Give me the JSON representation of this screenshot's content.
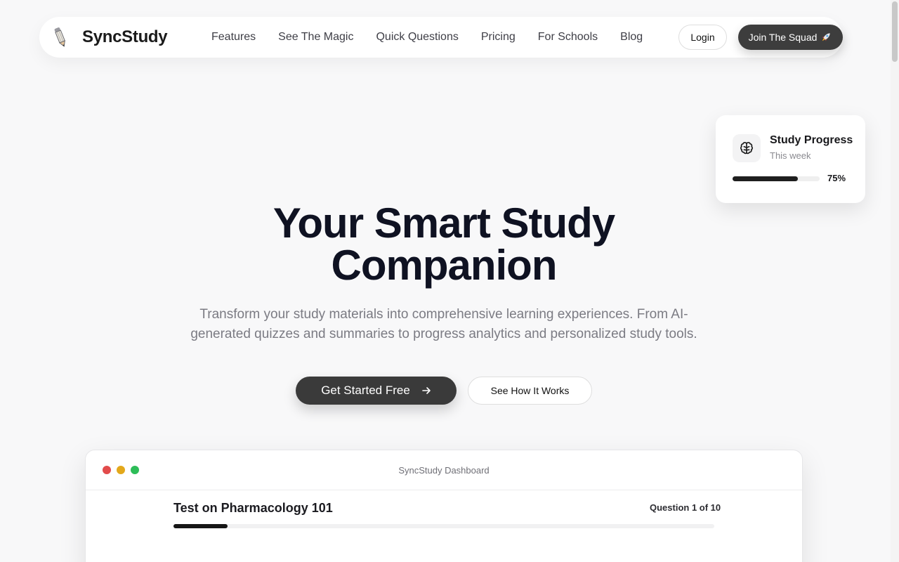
{
  "nav": {
    "brand": "SyncStudy",
    "logo_icon": "pencil-icon",
    "links": [
      "Features",
      "See The Magic",
      "Quick Questions",
      "Pricing",
      "For Schools",
      "Blog"
    ],
    "login_label": "Login",
    "join_label": "Join The Squad",
    "join_icon": "rocket-icon"
  },
  "progress_card": {
    "icon": "brain-icon",
    "title": "Study Progress",
    "subtitle": "This week",
    "percent_label": "75%",
    "progress": 0.75
  },
  "hero": {
    "title_line1": "Your Smart Study",
    "title_line2": "Companion",
    "subtitle": "Transform your study materials into comprehensive learning experiences. From AI-generated quizzes and summaries to progress analytics and personalized study tools.",
    "primary_cta": "Get Started Free",
    "primary_icon": "arrow-right-icon",
    "secondary_cta": "See How It Works"
  },
  "dashboard": {
    "window_title": "SyncStudy Dashboard",
    "quiz_title": "Test on Pharmacology 101",
    "question_count": "Question 1 of 10",
    "progress": 0.1
  },
  "colors": {
    "primary_dark": "#3a3a3a",
    "heading": "#0f1222",
    "window_red": "#e24b4b",
    "window_yellow": "#e3a81b",
    "window_green": "#2dbd58"
  }
}
